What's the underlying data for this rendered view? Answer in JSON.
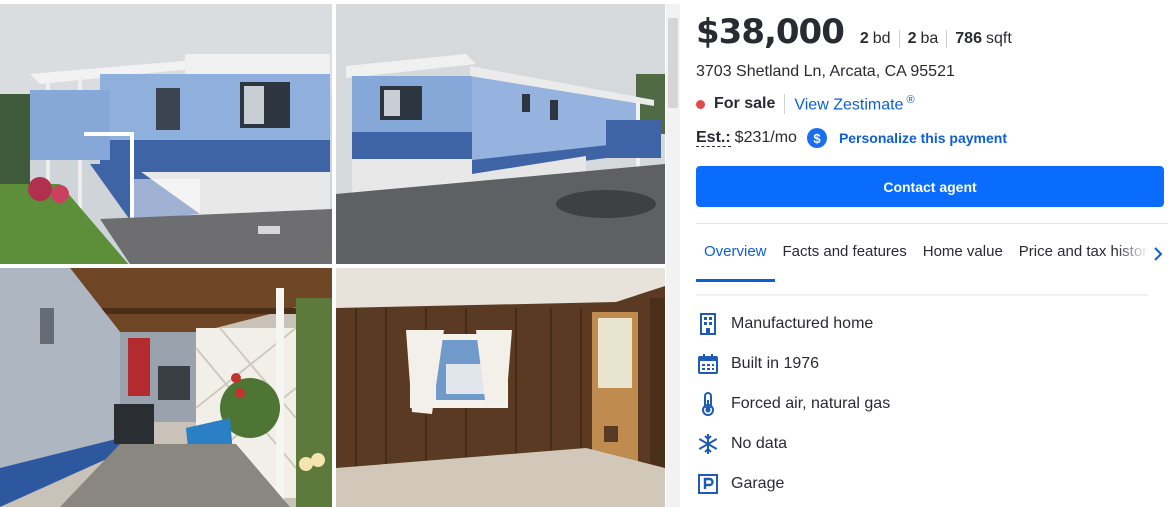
{
  "gallery": {
    "photos": [
      {
        "icon": "photo-exterior-front"
      },
      {
        "icon": "photo-exterior-side"
      },
      {
        "icon": "photo-carport-porch"
      },
      {
        "icon": "photo-interior-living-room"
      }
    ]
  },
  "listing": {
    "price": "$38,000",
    "beds": "2",
    "beds_unit": "bd",
    "baths": "2",
    "baths_unit": "ba",
    "sqft": "786",
    "sqft_unit": "sqft",
    "address": "3703 Shetland Ln, Arcata, CA 95521",
    "status": "For sale",
    "status_color": "#e54a4a",
    "zestimate_link": "View Zestimate",
    "zestimate_mark": "®",
    "est_label": "Est.:",
    "est_value": "$231/mo",
    "dollar_symbol": "$",
    "personalize_link": "Personalize this payment",
    "contact_button": "Contact agent"
  },
  "tabs": {
    "items": [
      {
        "label": "Overview",
        "active": true
      },
      {
        "label": "Facts and features",
        "active": false
      },
      {
        "label": "Home value",
        "active": false
      },
      {
        "label": "Price and tax history",
        "active": false
      }
    ],
    "next_icon": "chevron-right-icon"
  },
  "facts": [
    {
      "icon": "building-icon",
      "label": "Manufactured home"
    },
    {
      "icon": "calendar-icon",
      "label": "Built in 1976"
    },
    {
      "icon": "thermometer-icon",
      "label": "Forced air, natural gas"
    },
    {
      "icon": "snowflake-icon",
      "label": "No data"
    },
    {
      "icon": "parking-icon",
      "label": "Garage"
    }
  ],
  "colors": {
    "accent": "#0d5fd6",
    "button": "#0a6cff",
    "text": "#2a2a33",
    "icon": "#1f5bb5"
  }
}
